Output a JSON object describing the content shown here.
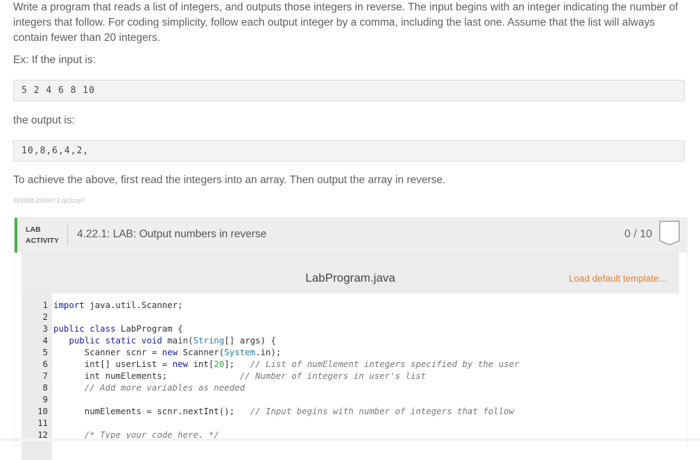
{
  "prompt": {
    "paragraph": "Write a program that reads a list of integers, and outputs those integers in reverse. The input begins with an integer indicating the number of integers that follow. For coding simplicity, follow each output integer by a comma, including the last one. Assume that the list will always contain fewer than 20 integers.",
    "example_label": "Ex: If the input is:",
    "example_input": "5 2 4 6 8 10",
    "output_label": "the output is:",
    "example_output": "10,8,6,4,2,",
    "hint": "To achieve the above, first read the integers into an array. Then output the array in reverse.",
    "reference_id": "383388.2946072.qx3zqy7"
  },
  "lab": {
    "tag_line1": "LAB",
    "tag_line2": "ACTIVITY",
    "title": "4.22.1: LAB: Output numbers in reverse",
    "score": "0 / 10",
    "accent_color": "#4caf50",
    "badge_icon": "score-badge-icon"
  },
  "editor": {
    "file_name": "LabProgram.java",
    "load_template_label": "Load default template...",
    "link_color": "#e8812f",
    "lines": [
      {
        "n": "1"
      },
      {
        "n": "2"
      },
      {
        "n": "3"
      },
      {
        "n": "4"
      },
      {
        "n": "5"
      },
      {
        "n": "6"
      },
      {
        "n": "7"
      },
      {
        "n": "8"
      },
      {
        "n": "9"
      },
      {
        "n": "10"
      },
      {
        "n": "11"
      },
      {
        "n": "12"
      }
    ],
    "code": {
      "l1_kw": "import",
      "l1_rest": " java.util.Scanner;",
      "l3_kw1": "public",
      "l3_kw2": "class",
      "l3_rest": " LabProgram {",
      "l4_kw1": "public",
      "l4_kw2": "static",
      "l4_kw3": "void",
      "l4_a": " main(",
      "l4_cls": "String",
      "l4_b": "[] args) {",
      "l5_a": "Scanner scnr = ",
      "l5_kw": "new",
      "l5_b": " Scanner(",
      "l5_cls": "System",
      "l5_c": ".in);",
      "l6_a": "int[] userList = ",
      "l6_kw": "new",
      "l6_b": " int[",
      "l6_num": "20",
      "l6_c": "];",
      "l6_cm": "// List of numElement integers specified by the user",
      "l7_a": "int numElements;",
      "l7_cm": "// Number of integers in user's list",
      "l8_cm": "// Add more variables as needed",
      "l10_a": "numElements = scnr.nextInt();",
      "l10_cm": "// Input begins with number of integers that follow",
      "l12_cm": "/* Type your code here. */"
    }
  }
}
